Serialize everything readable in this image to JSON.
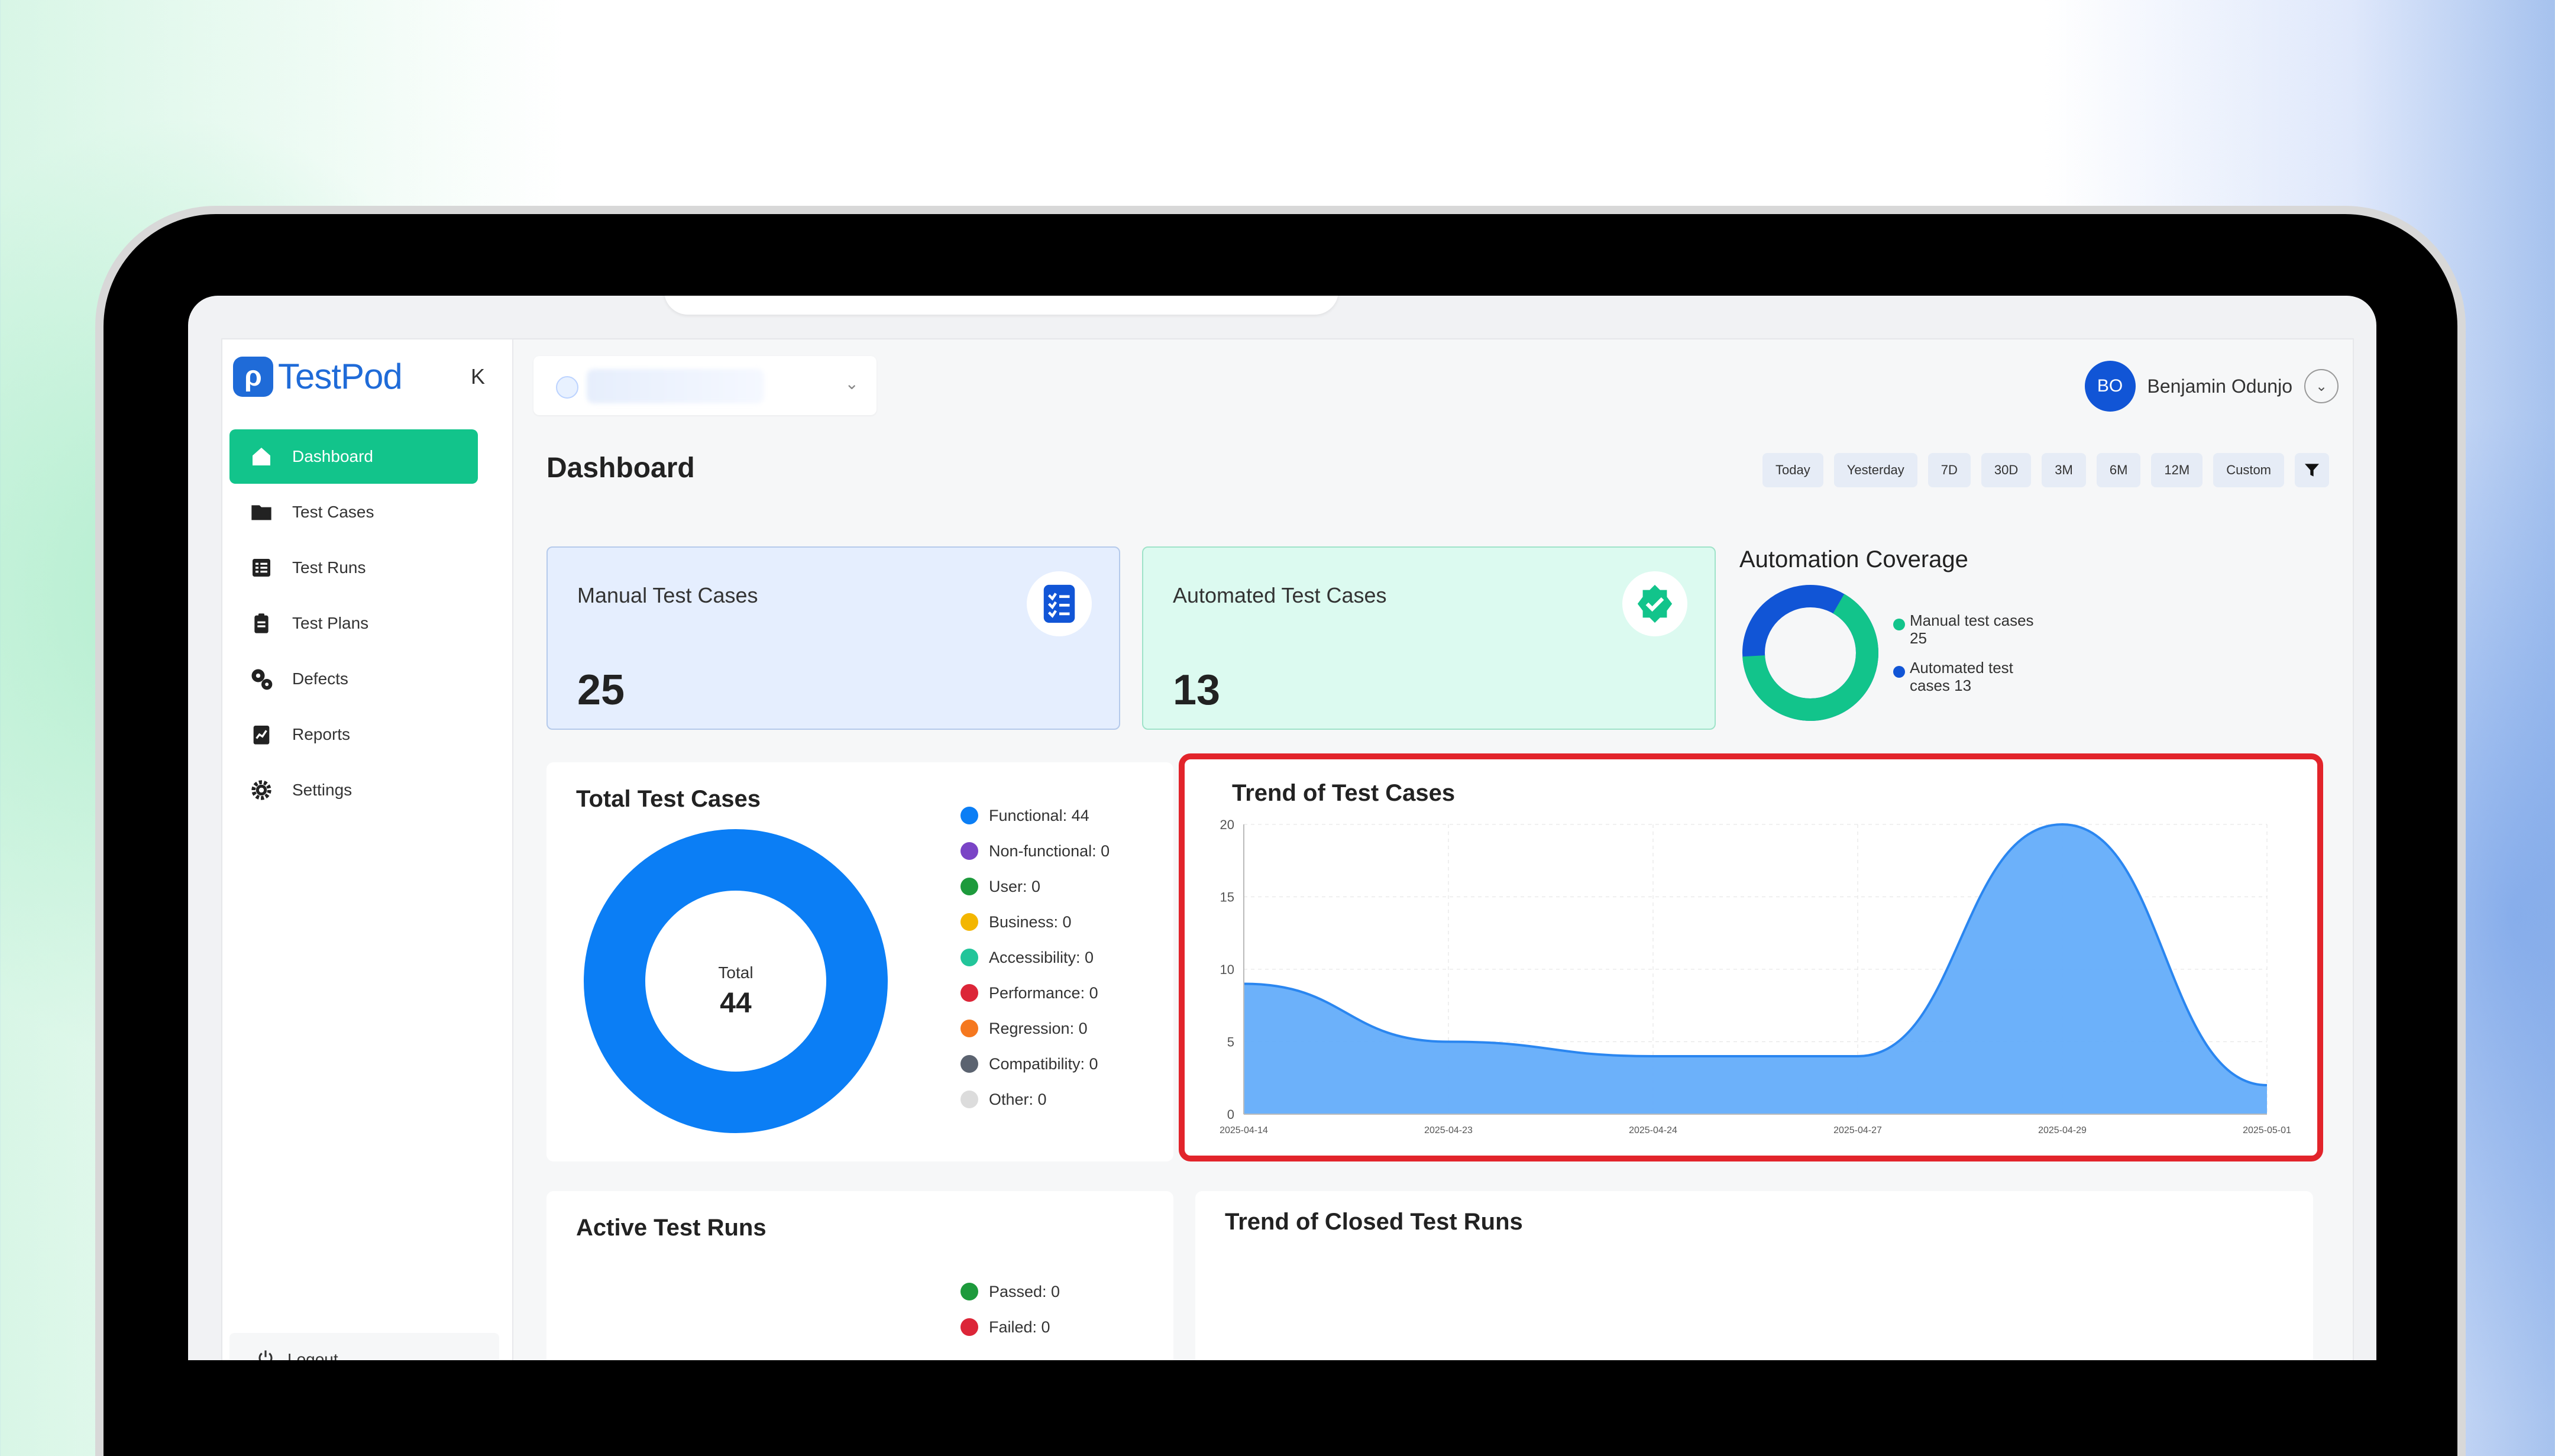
{
  "sidebar": {
    "logo_text": "TestPod",
    "collapse_label": "K",
    "items": [
      {
        "label": "Dashboard",
        "icon": "home-icon"
      },
      {
        "label": "Test Cases",
        "icon": "folder-icon"
      },
      {
        "label": "Test Runs",
        "icon": "list-icon"
      },
      {
        "label": "Test Plans",
        "icon": "clipboard-icon"
      },
      {
        "label": "Defects",
        "icon": "bug-gear-icon"
      },
      {
        "label": "Reports",
        "icon": "report-icon"
      },
      {
        "label": "Settings",
        "icon": "gear-icon"
      }
    ],
    "logout": "Logout"
  },
  "header": {
    "user_initials": "BO",
    "user_name": "Benjamin Odunjo"
  },
  "page": {
    "title": "Dashboard",
    "ranges": [
      "Today",
      "Yesterday",
      "7D",
      "30D",
      "3M",
      "6M",
      "12M",
      "Custom"
    ]
  },
  "stats": {
    "manual_label": "Manual Test Cases",
    "manual_value": "25",
    "auto_label": "Automated Test Cases",
    "auto_value": "13"
  },
  "coverage": {
    "title": "Automation Coverage",
    "legend": [
      {
        "label": "Manual test cases 25",
        "color": "#12c48b"
      },
      {
        "label": "Automated test cases 13",
        "color": "#1155d6"
      }
    ]
  },
  "total": {
    "title": "Total Test Cases",
    "center_label": "Total",
    "center_value": "44",
    "legend": [
      {
        "label": "Functional: 44",
        "color": "#0b7ef5"
      },
      {
        "label": "Non-functional: 0",
        "color": "#7a44c6"
      },
      {
        "label": "User: 0",
        "color": "#1d9a3c"
      },
      {
        "label": "Business: 0",
        "color": "#f3b600"
      },
      {
        "label": "Accessibility: 0",
        "color": "#22c59a"
      },
      {
        "label": "Performance: 0",
        "color": "#dc2638"
      },
      {
        "label": "Regression: 0",
        "color": "#f5781f"
      },
      {
        "label": "Compatibility: 0",
        "color": "#5b6370"
      },
      {
        "label": "Other: 0",
        "color": "#dcdcdc"
      }
    ]
  },
  "trend": {
    "title": "Trend of Test Cases"
  },
  "active_runs": {
    "title": "Active Test Runs",
    "legend": [
      {
        "label": "Passed: 0",
        "color": "#1d9a3c"
      },
      {
        "label": "Failed: 0",
        "color": "#dc2638"
      }
    ]
  },
  "closed_runs": {
    "title": "Trend of Closed Test Runs"
  },
  "chart_data": {
    "type": "area",
    "title": "Trend of Test Cases",
    "x": [
      "2025-04-14",
      "2025-04-23",
      "2025-04-24",
      "2025-04-27",
      "2025-04-29",
      "2025-05-01"
    ],
    "series": [
      {
        "values": [
          9,
          5,
          4,
          4,
          20,
          2
        ]
      }
    ],
    "ylim": [
      0,
      20
    ],
    "yticks": [
      0,
      5,
      10,
      15,
      20
    ],
    "grid": true,
    "color": "#64adfa"
  }
}
